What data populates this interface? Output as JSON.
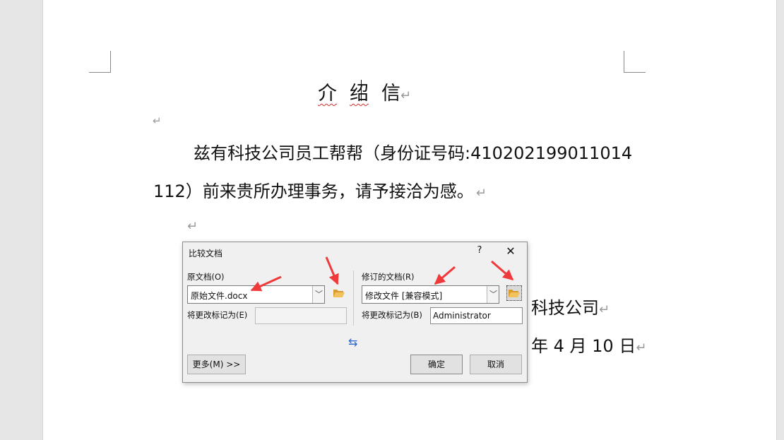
{
  "document": {
    "title_chars": [
      "介",
      "绍",
      "信"
    ],
    "body_line_1": "兹有科技公司员工帮帮（身份证号码:410202199011014",
    "body_line_2": "112）前来贵所办理事务，请予接洽为感。",
    "company_fragment": "科技公司",
    "date_fragment": "年 4 月 10 日",
    "paragraph_mark": "↵"
  },
  "dialog": {
    "title": "比较文档",
    "help": "?",
    "close": "✕",
    "original": {
      "label": "原文档(O)",
      "value": "原始文件.docx",
      "mark_label": "将更改标记为(E)",
      "mark_value": ""
    },
    "revised": {
      "label": "修订的文档(R)",
      "value": "修改文件 [兼容模式]",
      "mark_label": "将更改标记为(B)",
      "mark_value": "Administrator"
    },
    "swap_icon": "⇆",
    "more_button": "更多(M) >>",
    "ok_button": "确定",
    "cancel_button": "取消"
  },
  "colors": {
    "annotation_arrow": "#f0393a",
    "folder_icon": "#e8b04a",
    "swap_icon": "#2b66c9"
  }
}
